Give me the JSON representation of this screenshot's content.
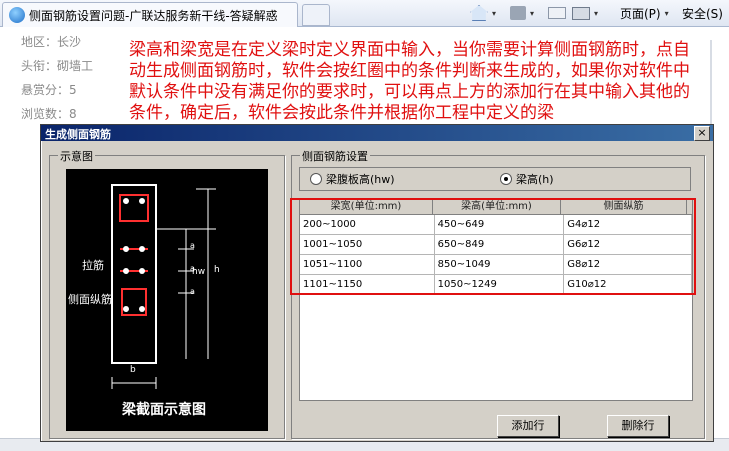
{
  "browser": {
    "tab_title": "侧面钢筋设置问题-广联达服务新干线-答疑解惑",
    "page_menu_label": "页面(P)",
    "safety_menu_label": "安全(S)",
    "dropdown_glyph": "▾"
  },
  "page_info": {
    "area": "地区：长沙",
    "title": "头衔：砌墙工",
    "bounty": "悬赏分：5",
    "views": "浏览数：8"
  },
  "overlay_text": "梁高和梁宽是在定义梁时定义界面中输入，当你需要计算侧面钢筋时，点自动生成侧面钢筋时，软件会按红圈中的条件判断来生成的，如果你对软件中默认条件中没有满足你的要求时，可以再点上方的添加行在其中输入其他的条件，确定后，软件会按此条件并根据你工程中定义的梁",
  "dialog": {
    "title": "生成侧面钢筋",
    "close_glyph": "×",
    "diagram_group_label": "示意图",
    "settings_group_label": "侧面钢筋设置",
    "diagram": {
      "label_tie": "拉筋",
      "label_side": "侧面纵筋",
      "label_hw": "hw",
      "label_h": "h",
      "label_a": "a",
      "label_b": "b",
      "caption": "梁截面示意图"
    },
    "radio_web": "梁腹板高(hw)",
    "radio_height": "梁高(h)",
    "table": {
      "headers": [
        "梁宽(单位:mm)",
        "梁高(单位:mm)",
        "侧面纵筋"
      ],
      "rows": [
        [
          "200~1000",
          "450~649",
          "G4⌀12"
        ],
        [
          "1001~1050",
          "650~849",
          "G6⌀12"
        ],
        [
          "1051~1100",
          "850~1049",
          "G8⌀12"
        ],
        [
          "1101~1150",
          "1050~1249",
          "G10⌀12"
        ]
      ]
    },
    "add_row_button": "添加行",
    "delete_row_button": "删除行"
  },
  "colors": {
    "annotation_red": "#e01010",
    "dialog_bg": "#d4d0c8",
    "title_bar": "#0a246a"
  }
}
